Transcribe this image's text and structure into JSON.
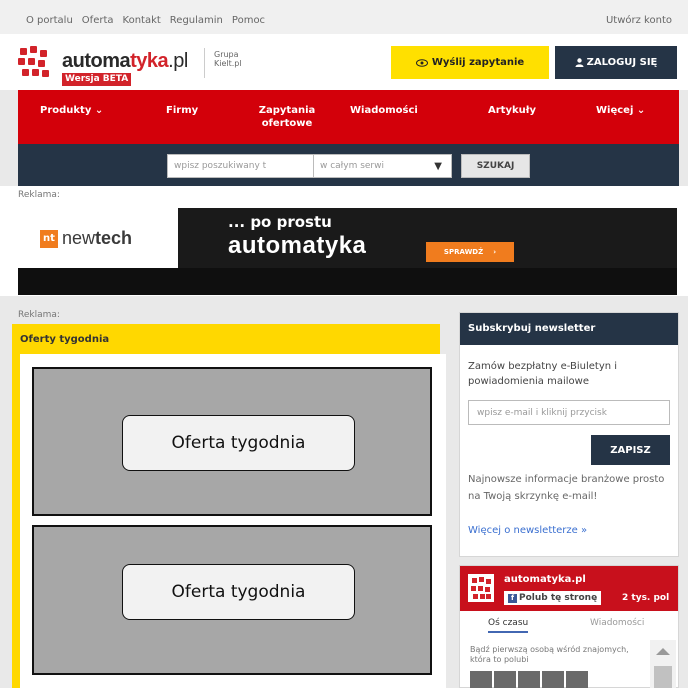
{
  "topbar": {
    "links": [
      "O portalu",
      "Oferta",
      "Kontakt",
      "Regulamin",
      "Pomoc"
    ],
    "create_account": "Utwórz konto"
  },
  "header": {
    "brand_part1": "automa",
    "brand_part2": "tyka",
    "brand_part3": ".pl",
    "beta": "Wersja BETA",
    "group_line1": "Grupa",
    "group_line2": "Kielt.pl",
    "send_button": "Wyślij zapytanie",
    "login_button": "ZALOGUJ SIĘ"
  },
  "nav": {
    "items": [
      {
        "label": "Produkty",
        "caret": "⌄"
      },
      {
        "label": "Firmy",
        "caret": ""
      },
      {
        "label": "Zapytania ofertowe",
        "caret": ""
      },
      {
        "label": "Wiadomości",
        "caret": ""
      },
      {
        "label": "Artykuły",
        "caret": ""
      },
      {
        "label": "Więcej",
        "caret": "⌄"
      }
    ]
  },
  "search": {
    "placeholder": "wpisz poszukiwany t",
    "scope": "w całym serwi",
    "scope_arrow": "▼",
    "button": "SZUKAJ"
  },
  "ad": {
    "label": "Reklama:",
    "logo_box": "nt",
    "logo_text_a": "new",
    "logo_text_b": "tech",
    "slogan_line1": "... po prostu",
    "slogan_line2": "automatyka",
    "cta_label": "SPRAWDŹ",
    "cta_arrow": "›"
  },
  "lower": {
    "label": "Reklama:"
  },
  "offers": {
    "title": "Oferty tygodnia",
    "items": [
      "Oferta tygodnia",
      "Oferta tygodnia"
    ]
  },
  "newsletter": {
    "title": "Subskrybuj newsletter",
    "description": "Zamów bezpłatny e-Biuletyn i powiadomienia mailowe",
    "input_placeholder": "wpisz e-mail i kliknij przycisk",
    "button": "ZAPISZ",
    "info": "Najnowsze informacje branżowe prosto na Twoją skrzynkę e-mail!",
    "more_link": "Więcej o newsletterze »"
  },
  "facebook": {
    "page_name": "automatyka.pl",
    "like_button": "Polub tę stronę",
    "like_icon": "f",
    "likes_count": "2 tys. pol",
    "tab_timeline": "Oś czasu",
    "tab_messages": "Wiadomości",
    "friends_text": "Bądź pierwszą osobą wśród znajomych, która to polubi"
  }
}
